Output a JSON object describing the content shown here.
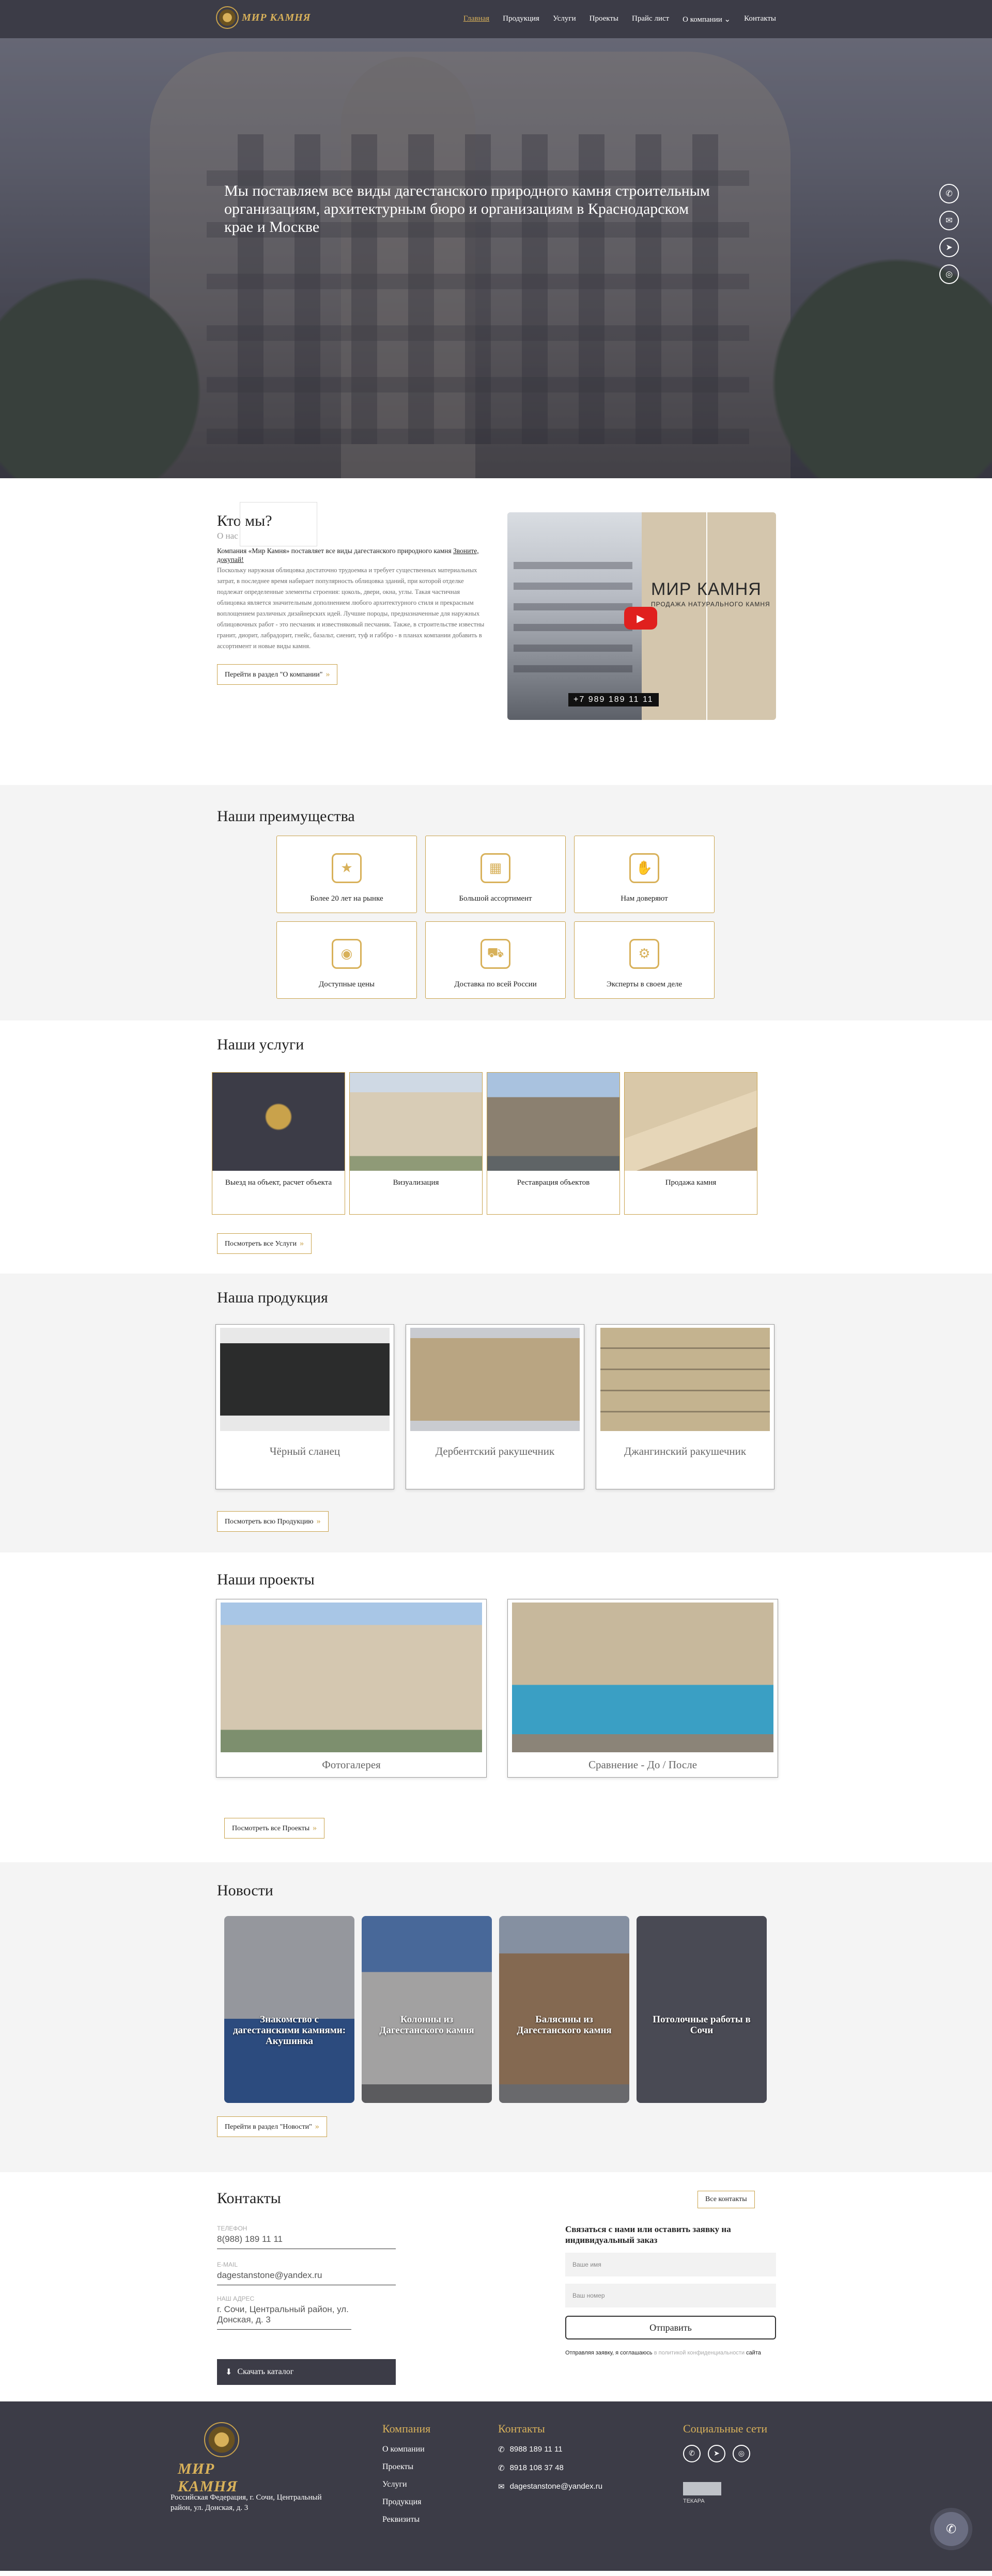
{
  "header": {
    "logo_text": "МИР КАМНЯ",
    "nav": [
      "Главная",
      "Продукция",
      "Услуги",
      "Проекты",
      "Прайс лист",
      "О компании",
      "Контакты"
    ]
  },
  "hero": {
    "title": "Мы поставляем все виды дагестанского природного камня строительным организациям, архитектурным бюро и организациям в Краснодарском крае и Москве",
    "social": [
      "phone-icon",
      "whatsapp-icon",
      "telegram-icon",
      "instagram-icon"
    ]
  },
  "about": {
    "title": "Кто мы?",
    "subtitle": "О нас",
    "p1_start": "Компания «Мир Камня» поставляет все виды дагестанского природного камня",
    "p1_link": "Звоните, докупай!",
    "p2": "Поскольку наружная облицовка достаточно трудоемка и требует существенных материальных затрат, в последнее время набирает популярность облицовка зданий, при которой отделке подлежат определенные элементы строения: цоколь, двери, окна, углы. Такая частичная облицовка является значительным дополнением любого архитектурного стиля и прекрасным воплощением различных дизайнерских идей. Лучшие породы, предназначенные для наружных облицовочных работ - это песчаник и известняковый песчаник. Также, в строительстве известны гранит, диорит, лабрадорит, гнейс, базальт, сиенит, туф и габбро - в планах компании добавить в ассортимент и новые виды камня.",
    "button": "Перейти в раздел \"О компании\"",
    "video_brand": "МИР КАМНЯ",
    "video_brand_sub": "ПРОДАЖА НАТУРАЛЬНОГО КАМНЯ",
    "video_phone": "+7 989 189 11 11"
  },
  "advantages": {
    "title": "Наши преимущества",
    "items": [
      {
        "label": "Более 20 лет на рынке",
        "icon": "award-icon"
      },
      {
        "label": "Большой ассортимент",
        "icon": "boxes-icon"
      },
      {
        "label": "Нам доверяют",
        "icon": "handshake-icon"
      },
      {
        "label": "Доступные цены",
        "icon": "coins-icon"
      },
      {
        "label": "Доставка по всей России",
        "icon": "truck-icon"
      },
      {
        "label": "Эксперты в своем деле",
        "icon": "expert-icon"
      }
    ]
  },
  "services": {
    "title": "Наши услуги",
    "items": [
      "Выезд на объект, расчет объекта",
      "Визуализация",
      "Реставрация объектов",
      "Продажа камня"
    ],
    "button": "Посмотреть все Услуги"
  },
  "products": {
    "title": "Наша продукция",
    "items": [
      "Чёрный сланец",
      "Дербентский ракушечник",
      "Джангинский ракушечник"
    ],
    "button": "Посмотреть всю Продукцию"
  },
  "projects": {
    "title": "Наши проекты",
    "items": [
      "Фотогалерея",
      "Сравнение - До / После"
    ],
    "button": "Посмотреть все Проекты"
  },
  "news": {
    "title": "Новости",
    "items": [
      "Знакомство с дагестанскими камнями: Акушинка",
      "Колонны из Дагестанского камня",
      "Балясины из Дагестанского камня",
      "Потолочные работы в Сочи"
    ],
    "button": "Перейти в раздел \"Новости\""
  },
  "contacts": {
    "title": "Контакты",
    "all_button": "Все контакты",
    "phone_label": "ТЕЛЕФОН",
    "phone": "8(988) 189 11 11",
    "email_label": "E-MAIL",
    "email": "dagestanstone@yandex.ru",
    "address_label": "НАШ АДРЕС",
    "address": "г. Сочи, Центральный район, ул. Донская, д. 3",
    "catalog_button": "Скачать каталог",
    "form_title": "Связаться с нами или оставить заявку на индивидуальный заказ",
    "name_placeholder": "Ваше имя",
    "phone_placeholder": "Ваш номер",
    "send_button": "Отправить",
    "agree_text": "Отправляя заявку, я соглашаюсь",
    "agree_gray": "в политикой конфиденциальности",
    "agree_end": "сайта"
  },
  "footer": {
    "logo_text": "МИР КАМНЯ",
    "address": "Российская Федерация, г. Сочи, Центральный район, ул. Донская, д. 3",
    "company_title": "Компания",
    "company_links": [
      "О компании",
      "Проекты",
      "Услуги",
      "Продукция",
      "Реквизиты"
    ],
    "contacts_title": "Контакты",
    "phone1": "8988 189 11 11",
    "phone2": "8918 108 37 48",
    "email": "dagestanstone@yandex.ru",
    "social_title": "Социальные сети",
    "dev_label": "ТЕКАРА"
  },
  "colors": {
    "accent": "#d8b15a",
    "dark": "#3c3c47"
  }
}
